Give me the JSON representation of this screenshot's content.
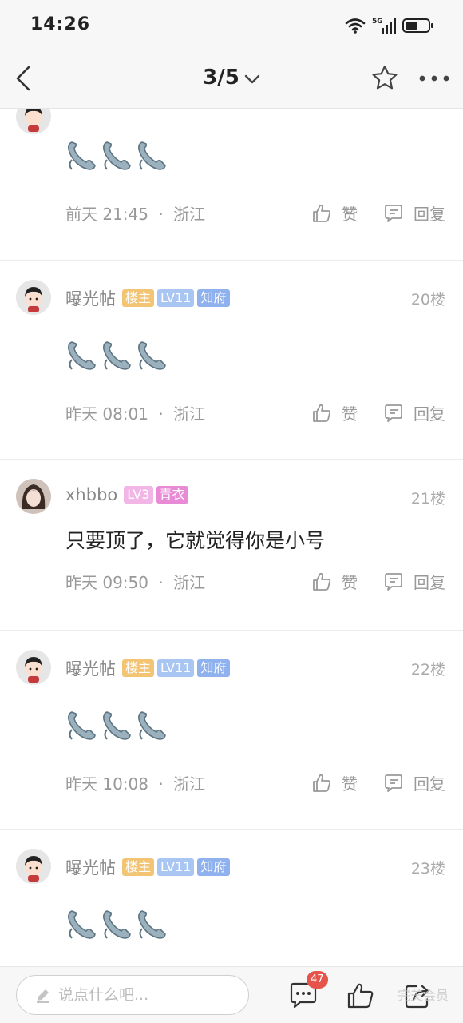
{
  "status_bar": {
    "time": "14:26",
    "network": "5G"
  },
  "nav": {
    "page_indicator": "3/5"
  },
  "posts": [
    {
      "time": "前天 21:45",
      "location": "浙江",
      "like_label": "赞",
      "reply_label": "回复"
    },
    {
      "username": "曝光帖",
      "badges": [
        "楼主",
        "LV11",
        "知府"
      ],
      "floor": "20楼",
      "time": "昨天 08:01",
      "location": "浙江",
      "like_label": "赞",
      "reply_label": "回复"
    },
    {
      "username": "xhbbo",
      "badges": [
        "LV3",
        "青衣"
      ],
      "floor": "21楼",
      "content": "只要顶了，它就觉得你是小号",
      "time": "昨天 09:50",
      "location": "浙江",
      "like_label": "赞",
      "reply_label": "回复"
    },
    {
      "username": "曝光帖",
      "badges": [
        "楼主",
        "LV11",
        "知府"
      ],
      "floor": "22楼",
      "time": "昨天 10:08",
      "location": "浙江",
      "like_label": "赞",
      "reply_label": "回复"
    },
    {
      "username": "曝光帖",
      "badges": [
        "楼主",
        "LV11",
        "知府"
      ],
      "floor": "23楼"
    }
  ],
  "separator": "·",
  "bottom_bar": {
    "input_placeholder": "说点什么吧...",
    "comment_count": "47",
    "watermark": "完美会员"
  },
  "colors": {
    "accent_red": "#e5534b",
    "badge_owner": "#f2c473",
    "badge_level": "#a9c6f3",
    "badge_rank": "#8fb2ee",
    "badge_lv3": "#f2b6e6",
    "badge_qingyi": "#e88ad6"
  },
  "icons": [
    "back-arrow-icon",
    "chevron-down-icon",
    "star-icon",
    "more-icon",
    "phone-emoji-icon",
    "thumb-up-icon",
    "reply-icon",
    "pencil-icon",
    "comment-icon",
    "share-icon",
    "wifi-icon",
    "signal-icon",
    "battery-icon"
  ]
}
